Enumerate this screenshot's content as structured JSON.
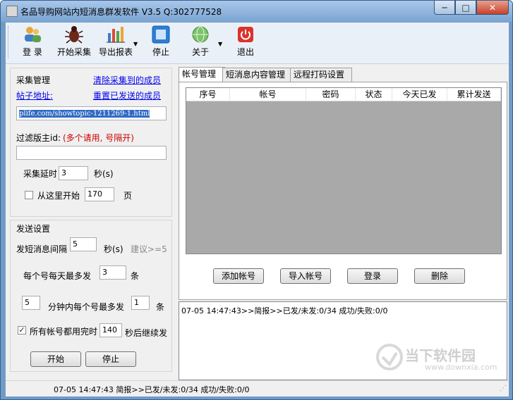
{
  "window": {
    "title": "名品导购网站内短消息群发软件 V3.5  Q:302777528",
    "minimize": "─",
    "maximize": "□",
    "close": "✕"
  },
  "toolbar": {
    "login": "登 录",
    "start_collect": "开始采集",
    "export_report": "导出报表",
    "stop": "停止",
    "about": "关于",
    "exit": "退出"
  },
  "collect": {
    "title": "采集管理",
    "clear_link": "清除采集到的成员",
    "post_url_label": "帖子地址:",
    "reset_link": "重置已发送的成员",
    "url_value": "plife.com/showtopic-1211269-1.html",
    "filter_label": "过滤版主id:",
    "filter_hint": "(多个请用, 号隔开)",
    "filter_value": "",
    "delay_label": "采集延时",
    "delay_value": "3",
    "delay_unit": "秒(s)",
    "from_here_label": "从这里开始",
    "from_here_checked": false,
    "page_value": "170",
    "page_unit": "页"
  },
  "send": {
    "title": "发送设置",
    "interval_label": "发短消息间隔",
    "interval_value": "5",
    "interval_unit": "秒(s)",
    "interval_hint": "建议>=5",
    "daily_label": "每个号每天最多发",
    "daily_value": "3",
    "daily_unit": "条",
    "minutes_value": "5",
    "minutes_label": "分钟内每个号最多发",
    "per_min_value": "1",
    "per_min_unit": "条",
    "continue_label": "所有帐号都用完时",
    "continue_checked": true,
    "continue_value": "140",
    "continue_unit": "秒后继续发",
    "start_button": "开始",
    "stop_button": "停止"
  },
  "tabs": [
    "帐号管理",
    "短消息内容管理",
    "远程打码设置"
  ],
  "accounts": {
    "columns": [
      "序号",
      "帐号",
      "密码",
      "状态",
      "今天已发",
      "累计发送"
    ],
    "rows": [],
    "add_button": "添加帐号",
    "import_button": "导入帐号",
    "login_button": "登录",
    "delete_button": "删除"
  },
  "log": {
    "line": "07-05 14:47:43>>简报>>已发/未发:0/34    成功/失败:0/0"
  },
  "statusbar": {
    "text": "07-05 14:47:43 简报>>已发/未发:0/34    成功/失败:0/0"
  },
  "watermark": {
    "brand": "当下软件园",
    "url": "www.downxia.com"
  },
  "colors": {
    "title_gradient_top": "#a9c7e9",
    "close_red": "#c7402a",
    "listview_bg": "#a9a9a9",
    "hint_red": "#cc0000",
    "link_blue": "#0000ee"
  }
}
